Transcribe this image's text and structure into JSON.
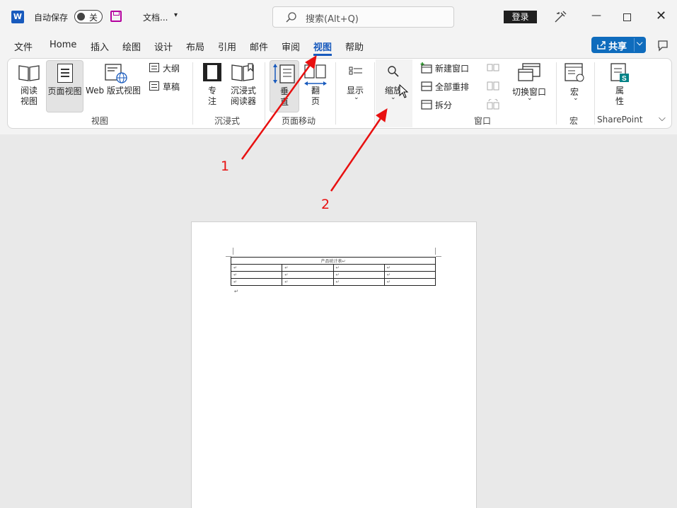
{
  "titlebar": {
    "autosave_label": "自动保存",
    "autosave_state": "关",
    "doc_title": "文档...",
    "search_placeholder": "搜索(Alt+Q)",
    "login_label": "登录"
  },
  "menu": {
    "items": [
      "文件",
      "Home",
      "插入",
      "绘图",
      "设计",
      "布局",
      "引用",
      "邮件",
      "审阅",
      "视图",
      "帮助"
    ],
    "active": "视图",
    "share_label": "共享"
  },
  "ribbon": {
    "views_group": {
      "label": "视图",
      "read_mode": "阅读\n视图",
      "print_layout": "页面视图",
      "web_layout": "Web 版式视图",
      "outline": "大纲",
      "draft": "草稿"
    },
    "immersive_group": {
      "label": "沉浸式",
      "focus": "专\n注",
      "immersive_reader": "沉浸式\n阅读器"
    },
    "page_movement_group": {
      "label": "页面移动",
      "vertical": "垂\n直",
      "side_to_side": "翻\n页"
    },
    "show_button": "显示",
    "zoom_button": "缩放",
    "window_group": {
      "label": "窗口",
      "new_window": "新建窗口",
      "arrange_all": "全部重排",
      "split": "拆分",
      "switch_windows": "切换窗口"
    },
    "macros_group": {
      "label": "宏",
      "macros": "宏"
    },
    "sharepoint_group": {
      "label": "SharePoint",
      "properties": "属\n性"
    }
  },
  "document": {
    "table_title": "产品统计表",
    "cell_mark": "↵"
  },
  "annotations": {
    "label_1": "1",
    "label_2": "2"
  },
  "colors": {
    "accent": "#185abd",
    "share": "#0f6cbd",
    "arrow": "#e81010"
  }
}
